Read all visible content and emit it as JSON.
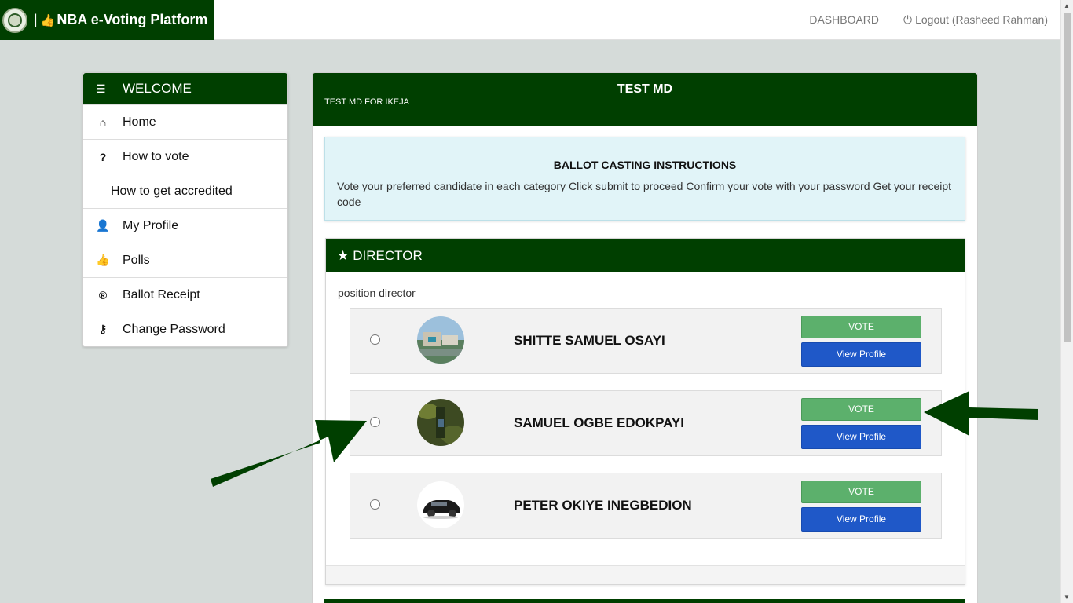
{
  "header": {
    "brand_separator": "|",
    "brand_title": "NBA e-Voting Platform",
    "dashboard": "DASHBOARD",
    "logout": "Logout (Rasheed Rahman)"
  },
  "sidebar": {
    "title": "WELCOME",
    "items": [
      {
        "label": "Home",
        "icon": "home-icon",
        "glyph": "⌂"
      },
      {
        "label": "How to vote",
        "icon": "question-icon",
        "glyph": "?"
      },
      {
        "label": "How to get accredited",
        "icon": "",
        "glyph": ""
      },
      {
        "label": "My Profile",
        "icon": "user-icon",
        "glyph": "👤"
      },
      {
        "label": "Polls",
        "icon": "thumbs-up-icon",
        "glyph": "👍"
      },
      {
        "label": "Ballot Receipt",
        "icon": "registered-icon",
        "glyph": "®"
      },
      {
        "label": "Change Password",
        "icon": "key-icon",
        "glyph": "⚷"
      }
    ]
  },
  "election": {
    "title": "TEST MD",
    "subtitle": "TEST MD FOR IKEJA"
  },
  "instructions": {
    "title": "BALLOT CASTING INSTRUCTIONS",
    "body": "Vote your preferred candidate in each category Click submit to proceed Confirm your vote with your password Get your receipt code"
  },
  "category": {
    "title": "DIRECTOR",
    "description": "position director",
    "vote_label": "VOTE",
    "profile_label": "View Profile",
    "candidates": [
      {
        "name": "SHITTE SAMUEL OSAYI"
      },
      {
        "name": "SAMUEL OGBE EDOKPAYI"
      },
      {
        "name": "PETER OKIYE INEGBEDION"
      }
    ]
  },
  "colors": {
    "brand_green": "#003f00",
    "vote_green": "#5cb06c",
    "profile_blue": "#1f58c8",
    "instructions_bg": "#e1f4f8"
  }
}
